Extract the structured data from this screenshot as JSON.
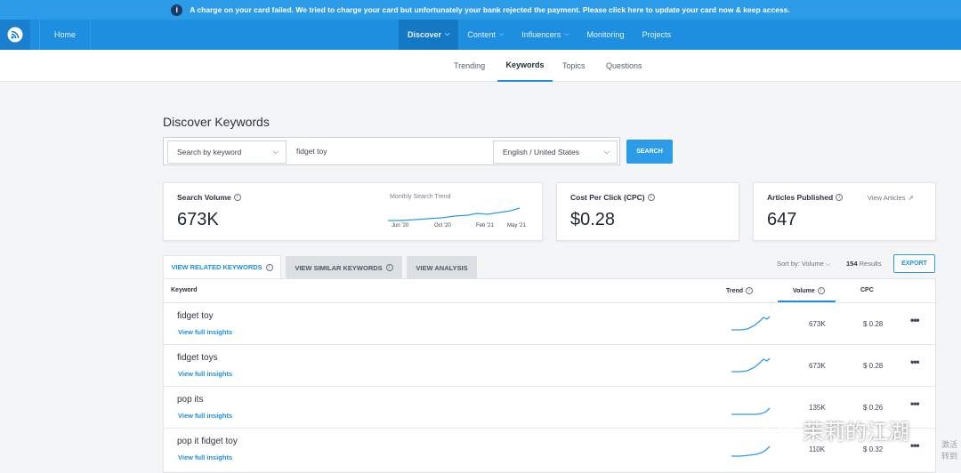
{
  "banner": {
    "text": "A charge on your card failed.  We tried to charge your card but unfortunately your bank rejected the payment.  Please click here to update your card now & keep access."
  },
  "nav": {
    "home": "Home",
    "items": [
      {
        "label": "Discover",
        "dropdown": true,
        "active": true
      },
      {
        "label": "Content",
        "dropdown": true
      },
      {
        "label": "Influencers",
        "dropdown": true
      },
      {
        "label": "Monitoring",
        "dropdown": false
      },
      {
        "label": "Projects",
        "dropdown": false
      }
    ]
  },
  "subnav": {
    "tabs": [
      "Trending",
      "Keywords",
      "Topics",
      "Questions"
    ],
    "active": "Keywords"
  },
  "page": {
    "title": "Discover Keywords"
  },
  "search": {
    "mode": "Search by keyword",
    "query": "fidget toy",
    "locale": "English / United States",
    "button": "SEARCH"
  },
  "cards": {
    "search_volume": {
      "label": "Search Volume",
      "value": "673K",
      "trend_label": "Monthly Search Trend",
      "ticks": [
        "Jun '20",
        "Oct '20",
        "Feb '21",
        "May '21"
      ]
    },
    "cpc": {
      "label": "Cost Per Click (CPC)",
      "value": "$0.28"
    },
    "articles": {
      "label": "Articles Published",
      "value": "647",
      "link": "View Articles"
    }
  },
  "results_tabs": [
    {
      "label": "VIEW RELATED KEYWORDS",
      "active": true
    },
    {
      "label": "VIEW SIMILAR KEYWORDS",
      "active": false
    },
    {
      "label": "VIEW ANALYSIS",
      "active": false
    }
  ],
  "results_meta": {
    "sort": "Sort by: Volume",
    "count": "154",
    "count_suffix": "Results",
    "export": "EXPORT"
  },
  "table": {
    "headers": {
      "keyword": "Keyword",
      "trend": "Trend",
      "volume": "Volume",
      "cpc": "CPC"
    },
    "insights_link": "View full insights",
    "rows": [
      {
        "keyword": "fidget toy",
        "volume": "673K",
        "cpc": "$ 0.28"
      },
      {
        "keyword": "fidget toys",
        "volume": "673K",
        "cpc": "$ 0.28"
      },
      {
        "keyword": "pop its",
        "volume": "135K",
        "cpc": "$ 0.26"
      },
      {
        "keyword": "pop it fidget toy",
        "volume": "110K",
        "cpc": "$ 0.32"
      }
    ]
  },
  "watermark": {
    "text": "茉莉的江湖",
    "side": "激活 转到"
  },
  "colors": {
    "accent": "#1e8fdf",
    "banner": "#2d9ce8",
    "nav": "#1e8fdf"
  },
  "icons": {
    "rss": "rss-logo-icon",
    "info": "info-icon",
    "external": "external-link-icon",
    "more": "more-dots-icon"
  }
}
